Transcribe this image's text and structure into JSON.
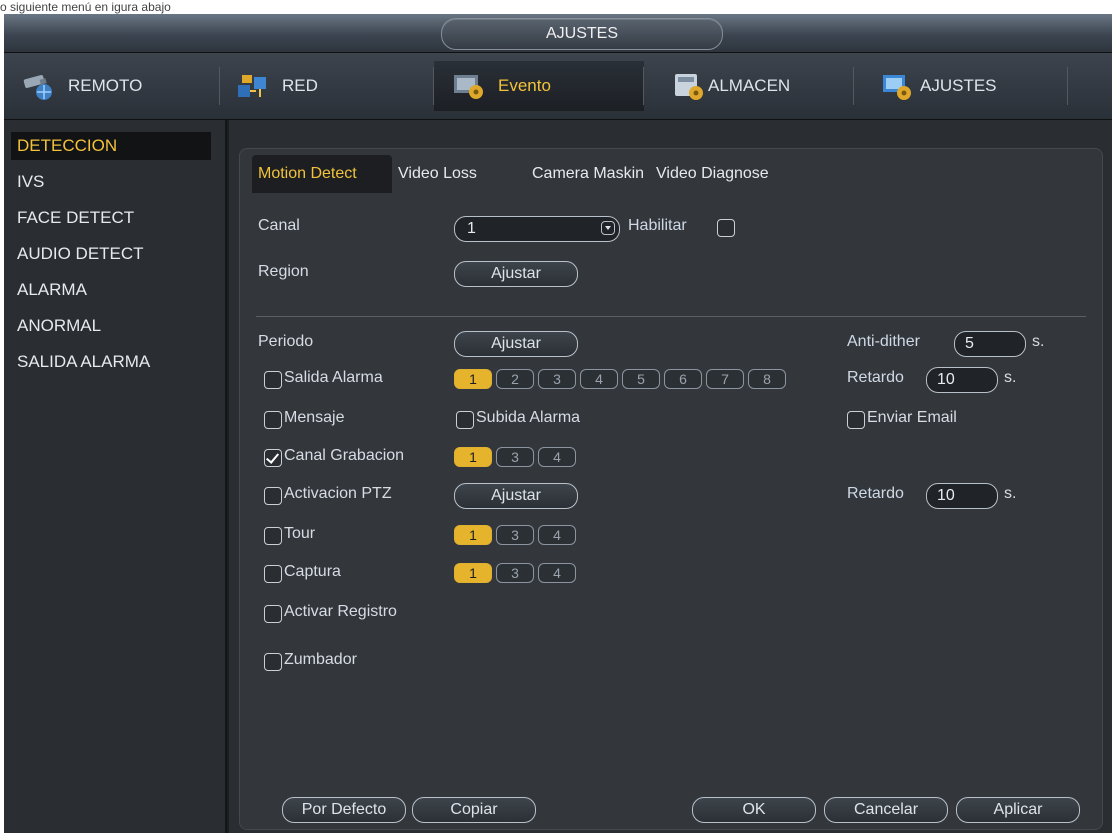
{
  "caption": "o siguiente menú en igura abajo",
  "title": "AJUSTES",
  "tabs": [
    {
      "label": "REMOTO",
      "icon": "camera-network-icon",
      "active": false
    },
    {
      "label": "RED",
      "icon": "network-icon",
      "active": false
    },
    {
      "label": "Evento",
      "icon": "event-icon",
      "active": true
    },
    {
      "label": "ALMACEN",
      "icon": "storage-icon",
      "active": false
    },
    {
      "label": "AJUSTES",
      "icon": "settings-icon",
      "active": false
    }
  ],
  "sidebar": {
    "items": [
      {
        "label": "DETECCION",
        "active": true
      },
      {
        "label": "IVS"
      },
      {
        "label": "FACE DETECT"
      },
      {
        "label": "AUDIO DETECT"
      },
      {
        "label": "ALARMA"
      },
      {
        "label": "ANORMAL"
      },
      {
        "label": "SALIDA ALARMA"
      }
    ]
  },
  "subtabs": [
    "Motion Detect",
    "Video Loss",
    "Camera Maskin",
    "Video Diagnose"
  ],
  "form": {
    "canal_label": "Canal",
    "canal_value": "1",
    "habilitar_label": "Habilitar",
    "region_label": "Region",
    "ajustar": "Ajustar",
    "periodo_label": "Periodo",
    "anti_dither_label": "Anti-dither",
    "anti_dither_value": "5",
    "unit_s": "s.",
    "salida_alarma_label": "Salida Alarma",
    "salida_alarma_outputs": [
      "1",
      "2",
      "3",
      "4",
      "5",
      "6",
      "7",
      "8"
    ],
    "retardo_label": "Retardo",
    "retardo_value": "10",
    "mensaje_label": "Mensaje",
    "subida_alarma_label": "Subida Alarma",
    "enviar_email_label": "Enviar Email",
    "canal_grabacion_label": "Canal Grabacion",
    "canal_grabacion_checked": true,
    "channels": [
      "1",
      "3",
      "4"
    ],
    "activacion_ptz_label": "Activacion PTZ",
    "retardo2_value": "10",
    "tour_label": "Tour",
    "captura_label": "Captura",
    "activar_registro_label": "Activar Registro",
    "zumbador_label": "Zumbador"
  },
  "footer": {
    "default": "Por Defecto",
    "copy": "Copiar",
    "ok": "OK",
    "cancel": "Cancelar",
    "apply": "Aplicar"
  }
}
